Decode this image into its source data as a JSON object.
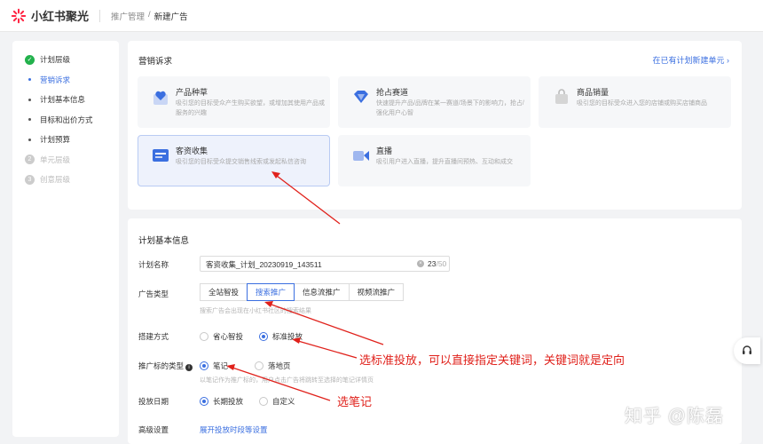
{
  "app": {
    "name": "小红书聚光"
  },
  "breadcrumb": {
    "parent": "推广管理",
    "separator": "/",
    "current": "新建广告"
  },
  "sidebar": {
    "plan_level": "计划层级",
    "items": [
      {
        "label": "营销诉求"
      },
      {
        "label": "计划基本信息"
      },
      {
        "label": "目标和出价方式"
      },
      {
        "label": "计划预算"
      }
    ],
    "unit_level": {
      "num": "2",
      "label": "单元层级"
    },
    "creative_level": {
      "num": "3",
      "label": "创意层级"
    }
  },
  "marketing": {
    "title": "营销诉求",
    "link": "在已有计划新建单元",
    "cards": [
      {
        "title": "产品种草",
        "desc": "吸引您的目标受众产生购买欲望，或增加其使用产品或服务的兴趣"
      },
      {
        "title": "抢占赛道",
        "desc": "快速提升产品/品牌在某一赛道/场景下的影响力，抢占/强化用户心智"
      },
      {
        "title": "商品销量",
        "desc": "吸引您的目标受众进入您的店铺或购买店铺商品"
      },
      {
        "title": "客资收集",
        "desc": "吸引您的目标受众提交销售线索或发起私信咨询"
      },
      {
        "title": "直播",
        "desc": "吸引用户进入直播，提升直播间预热、互动和成交"
      }
    ]
  },
  "basic": {
    "title": "计划基本信息",
    "plan_name_label": "计划名称",
    "plan_name_value": "客资收集_计划_20230919_143511",
    "char_count": "23",
    "char_max": "/50",
    "ad_type_label": "广告类型",
    "ad_types": [
      "全站智投",
      "搜索推广",
      "信息流推广",
      "视频流推广"
    ],
    "ad_type_hint": "搜索广告会出现在小红书社区的搜索结果",
    "build_label": "搭建方式",
    "build_options": [
      "省心智投",
      "标准投放"
    ],
    "target_label": "推广标的类型",
    "target_options": [
      "笔记",
      "落地页"
    ],
    "target_hint": "以笔记作为推广标的，用户点击广告将跳转至选择的笔记详情页",
    "date_label": "投放日期",
    "date_options": [
      "长期投放",
      "自定义"
    ],
    "advanced_label": "高级设置",
    "advanced_link": "展开投放时段等设置"
  },
  "annotations": {
    "a1": "选标准投放，可以直接指定关键词，关键词就是定向",
    "a2": "选笔记"
  },
  "watermark": "知乎 @陈磊",
  "colors": {
    "accent": "#3b6fe0",
    "annotation": "#e0211b",
    "success": "#22b14c"
  }
}
